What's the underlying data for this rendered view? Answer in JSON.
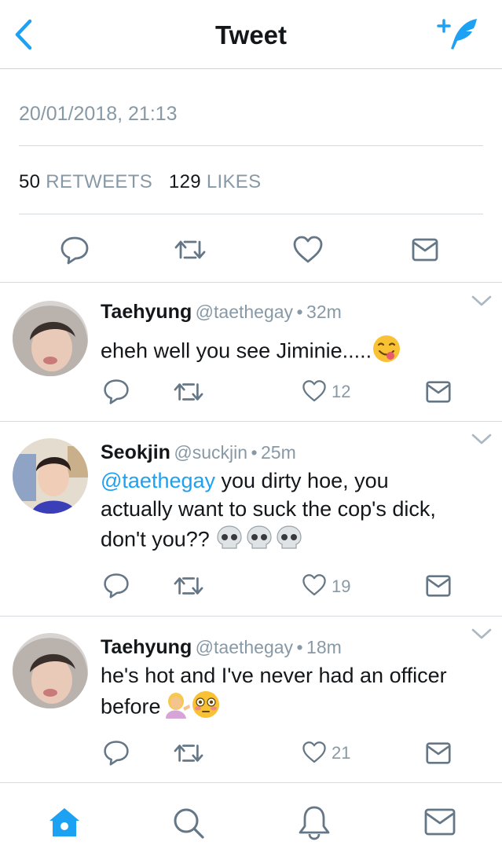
{
  "nav": {
    "title": "Tweet",
    "back_icon": "back-chevron-icon",
    "compose_icon": "compose-tweet-icon"
  },
  "detail": {
    "timestamp": "20/01/2018, 21:13",
    "retweets_count": "50",
    "retweets_label": "RETWEETS",
    "likes_count": "129",
    "likes_label": "LIKES"
  },
  "replies": [
    {
      "name": "Taehyung",
      "handle": "@taethegay",
      "sep": "•",
      "time": "32m",
      "text": "eheh well you see Jiminie.....",
      "emoji": "yum-face-emoji",
      "likes": "12"
    },
    {
      "name": "Seokjin",
      "handle": "@suckjin",
      "sep": "•",
      "time": "25m",
      "mention": "@taethegay",
      "text_line1": " you dirty hoe, you",
      "text_line2": "actually want to suck the cop's dick,",
      "text_line3": "don't you?? ",
      "emoji": "skull-emoji",
      "likes": "19"
    },
    {
      "name": "Taehyung",
      "handle": "@taethegay",
      "sep": "•",
      "time": "18m",
      "text_line1": "he's hot and I've never had an officer",
      "text_line2": "before",
      "emoji": [
        "woman-tipping-hand-emoji",
        "flushed-face-emoji"
      ],
      "likes": "21"
    }
  ],
  "tabbar": [
    "home-icon",
    "search-icon",
    "notifications-icon",
    "messages-icon"
  ],
  "colors": {
    "accent": "#1da1f2",
    "muted": "#8899a6",
    "text": "#14171a",
    "divider": "#d6dadd"
  }
}
